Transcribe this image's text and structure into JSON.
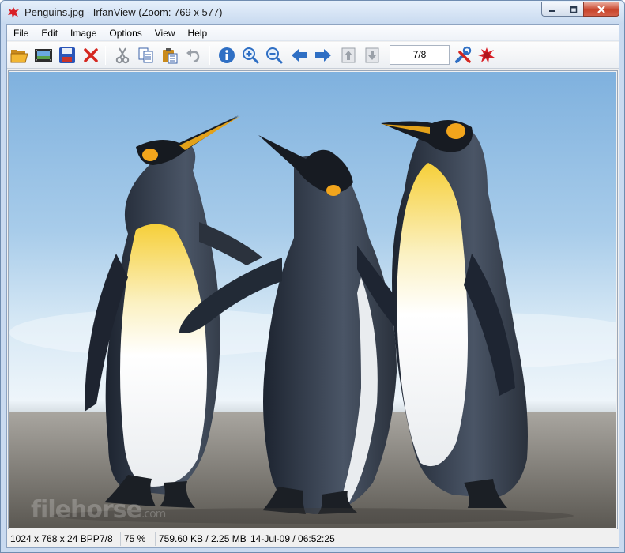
{
  "window": {
    "title": "Penguins.jpg - IrfanView (Zoom: 769 x 577)"
  },
  "menu": [
    {
      "label": "File"
    },
    {
      "label": "Edit"
    },
    {
      "label": "Image"
    },
    {
      "label": "Options"
    },
    {
      "label": "View"
    },
    {
      "label": "Help"
    }
  ],
  "toolbar": {
    "buttons": [
      {
        "icon": "open-folder-icon"
      },
      {
        "icon": "slideshow-icon"
      },
      {
        "icon": "save-icon"
      },
      {
        "icon": "delete-icon"
      },
      {
        "icon": "cut-icon"
      },
      {
        "icon": "copy-icon"
      },
      {
        "icon": "paste-icon"
      },
      {
        "icon": "undo-icon"
      },
      {
        "icon": "info-icon"
      },
      {
        "icon": "zoom-in-icon"
      },
      {
        "icon": "zoom-out-icon"
      },
      {
        "icon": "previous-icon"
      },
      {
        "icon": "next-icon"
      },
      {
        "icon": "first-image-icon"
      },
      {
        "icon": "last-image-icon"
      },
      {
        "icon": "properties-icon"
      },
      {
        "icon": "irfanview-logo-icon"
      }
    ],
    "page_indicator": "7/8"
  },
  "image": {
    "watermark_main": "filehorse",
    "watermark_suffix": ".com"
  },
  "status": {
    "dimensions": "1024 x 768 x 24 BPP",
    "index": "7/8",
    "zoom": "75 %",
    "size": "759.60 KB / 2.25 MB",
    "date": "14-Jul-09 / 06:52:25"
  },
  "colors": {
    "accent": "#2f6fc4",
    "close_button": "#c8452c"
  }
}
